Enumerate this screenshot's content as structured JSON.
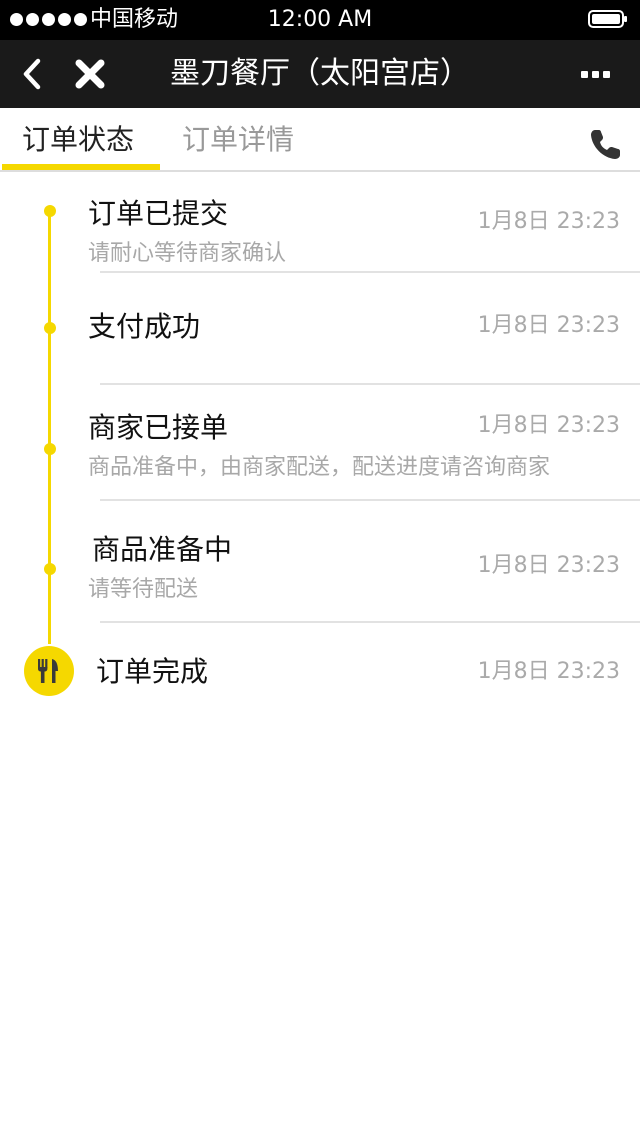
{
  "status_bar": {
    "carrier": "中国移动",
    "time": "12:00 AM"
  },
  "nav": {
    "title": "墨刀餐厅（太阳宫店）"
  },
  "tabs": [
    {
      "label": "订单状态",
      "active": true
    },
    {
      "label": "订单详情",
      "active": false
    }
  ],
  "steps": [
    {
      "title": "订单已提交",
      "subtitle": "请耐心等待商家确认",
      "time": "1月8日 23:23"
    },
    {
      "title": "支付成功",
      "subtitle": "",
      "time": "1月8日 23:23"
    },
    {
      "title": "商家已接单",
      "subtitle": "商品准备中，由商家配送，配送进度请咨询商家",
      "time": "1月8日 23:23"
    },
    {
      "title": "商品准备中",
      "subtitle": "请等待配送",
      "time": "1月8日 23:23"
    },
    {
      "title": "订单完成",
      "subtitle": "",
      "time": "1月8日 23:23"
    }
  ],
  "colors": {
    "accent": "#f5d800",
    "nav_background": "#1a1a1a"
  },
  "icons": {
    "back": "chevron-left-icon",
    "close": "close-icon",
    "more": "more-dots-icon",
    "phone": "phone-icon",
    "final_step": "fork-knife-icon"
  }
}
